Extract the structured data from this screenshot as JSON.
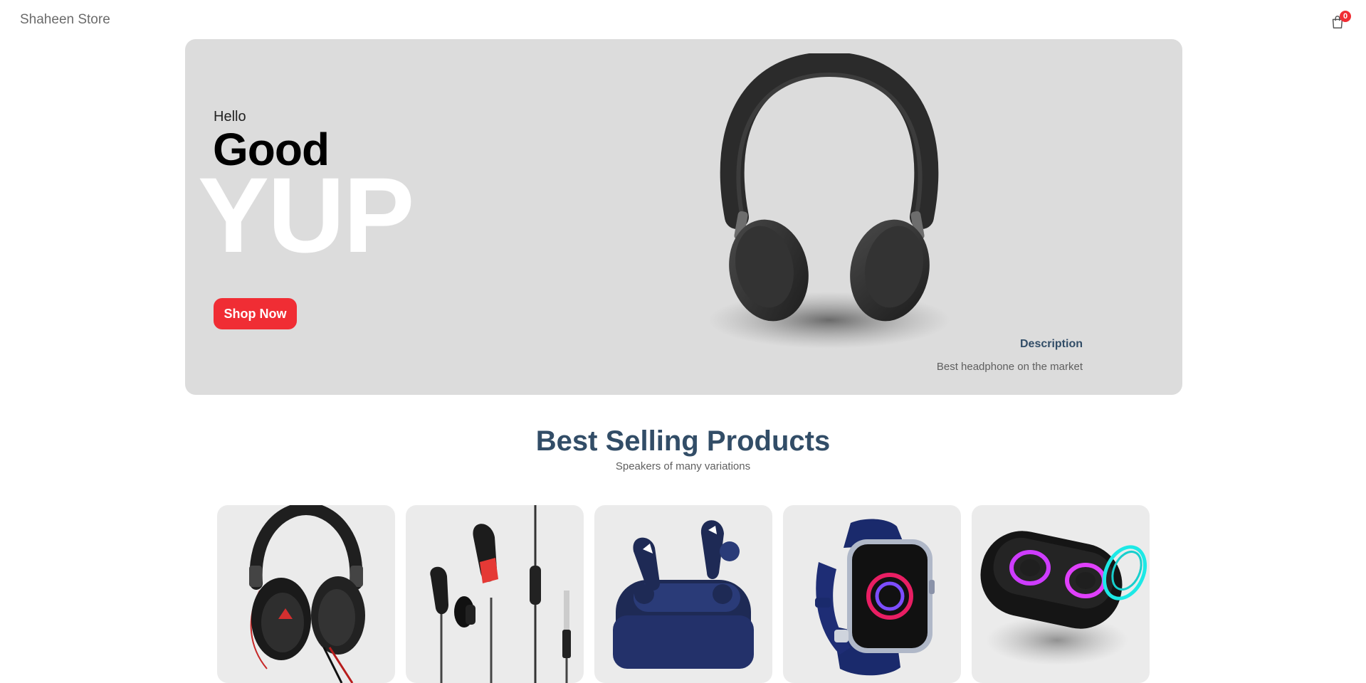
{
  "navbar": {
    "brand": "Shaheen Store",
    "cart_icon": "shopping-bag-icon",
    "cart_count": "0"
  },
  "hero": {
    "small_text": "Hello",
    "mid_text": "Good",
    "large_text": "YUP",
    "button_label": "Shop Now",
    "image": "headphones-image",
    "desc_title": "Description",
    "desc_text": "Best headphone on the market"
  },
  "products_section": {
    "title": "Best Selling Products",
    "subtitle": "Speakers of many variations"
  },
  "products": [
    {
      "image": "over-ear-headphones-image"
    },
    {
      "image": "wired-earphones-image"
    },
    {
      "image": "wireless-earbuds-image"
    },
    {
      "image": "smartwatch-image"
    },
    {
      "image": "bluetooth-speaker-image"
    }
  ],
  "colors": {
    "accent": "#f02d34",
    "heading": "#324d67",
    "hero_bg": "#dcdcdc",
    "card_bg": "#ebebeb"
  }
}
